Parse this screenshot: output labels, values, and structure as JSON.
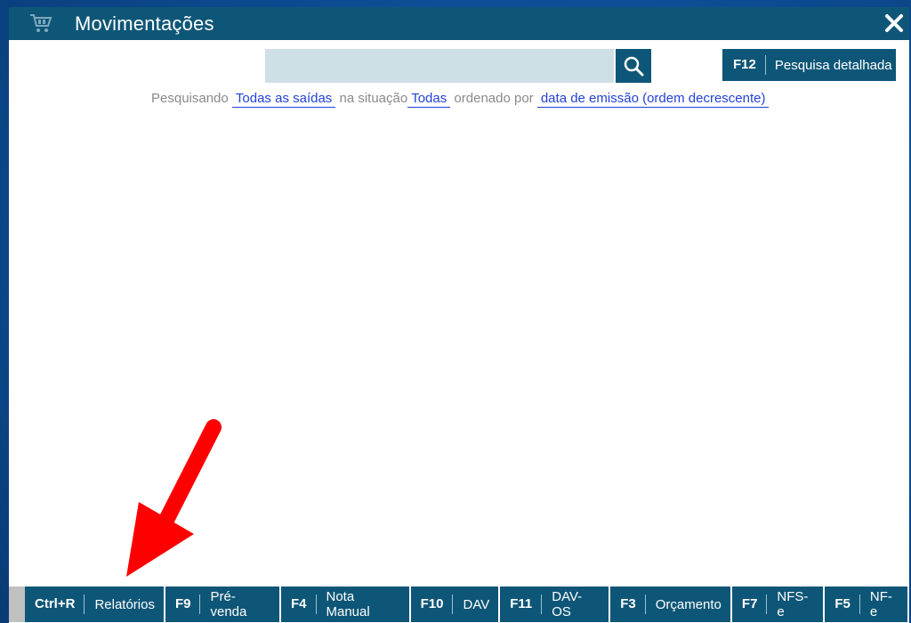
{
  "window": {
    "title": "Movimentações",
    "icon": "shopping-cart-icon",
    "close_icon": "close-icon"
  },
  "search": {
    "value": "",
    "placeholder": "",
    "button_icon": "search-icon"
  },
  "advanced_search": {
    "key": "F12",
    "label": "Pesquisa detalhada"
  },
  "filter": {
    "prefix": "Pesquisando",
    "type_value": "Todas as saídas",
    "situation_prefix": "na situação",
    "situation_value": "Todas",
    "order_prefix": "ordenado por",
    "order_value": "data de emissão (ordem decrescente)"
  },
  "function_keys": [
    {
      "key": "Ctrl+R",
      "label": "Relatórios"
    },
    {
      "key": "F9",
      "label": "Pré-venda"
    },
    {
      "key": "F4",
      "label": "Nota Manual"
    },
    {
      "key": "F10",
      "label": "DAV"
    },
    {
      "key": "F11",
      "label": "DAV-OS"
    },
    {
      "key": "F3",
      "label": "Orçamento"
    },
    {
      "key": "F7",
      "label": "NFS-e"
    },
    {
      "key": "F5",
      "label": "NF-e"
    }
  ],
  "colors": {
    "primary": "#0e5677",
    "link": "#2342d6",
    "arrow": "#ff0000",
    "search_bg": "#cfdfe6"
  }
}
